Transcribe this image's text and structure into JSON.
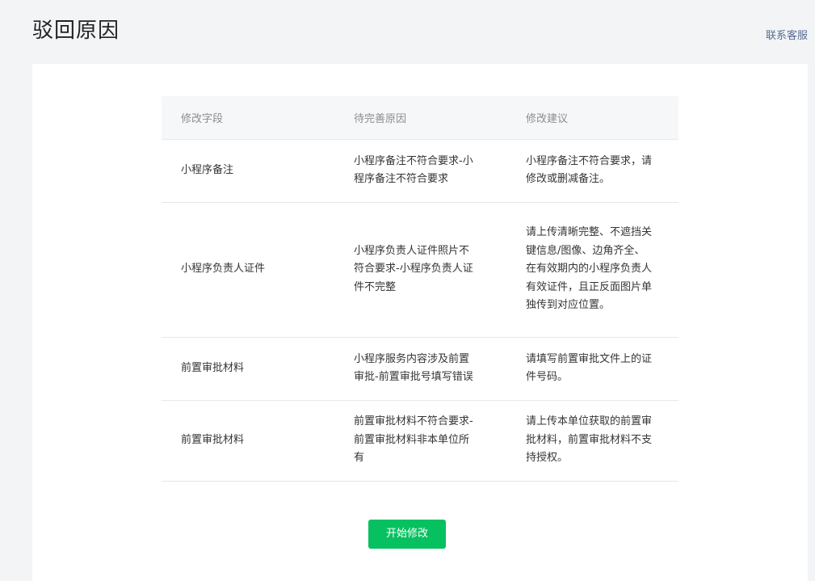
{
  "header": {
    "title": "驳回原因",
    "contact_link": "联系客服"
  },
  "table": {
    "columns": [
      "修改字段",
      "待完善原因",
      "修改建议"
    ],
    "rows": [
      {
        "field": "小程序备注",
        "reason": "小程序备注不符合要求-小程序备注不符合要求",
        "suggestion": "小程序备注不符合要求，请修改或删减备注。"
      },
      {
        "field": "小程序负责人证件",
        "reason": "小程序负责人证件照片不符合要求-小程序负责人证件不完整",
        "suggestion": "请上传清晰完整、不遮挡关键信息/图像、边角齐全、在有效期内的小程序负责人有效证件，且正反面图片单独传到对应位置。"
      },
      {
        "field": "前置审批材料",
        "reason": "小程序服务内容涉及前置审批-前置审批号填写错误",
        "suggestion": "请填写前置审批文件上的证件号码。"
      },
      {
        "field": "前置审批材料",
        "reason": "前置审批材料不符合要求-前置审批材料非本单位所有",
        "suggestion": "请上传本单位获取的前置审批材料，前置审批材料不支持授权。"
      }
    ]
  },
  "actions": {
    "start_button": "开始修改"
  },
  "colors": {
    "accent": "#07c160",
    "link": "#576b95",
    "page_bg": "#f3f4f6",
    "table_header_bg": "#f6f7f9"
  }
}
